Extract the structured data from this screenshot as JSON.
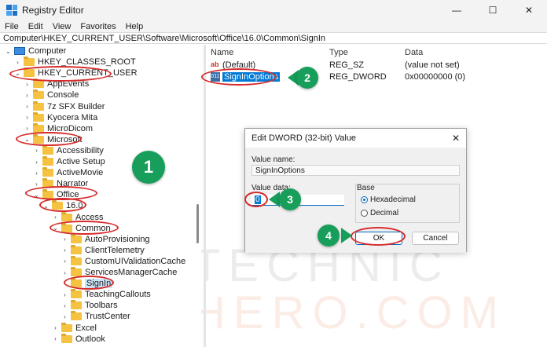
{
  "window": {
    "title": "Registry Editor",
    "minimize": "—",
    "maximize": "☐",
    "close": "✕"
  },
  "menu": [
    "File",
    "Edit",
    "View",
    "Favorites",
    "Help"
  ],
  "address": "Computer\\HKEY_CURRENT_USER\\Software\\Microsoft\\Office\\16.0\\Common\\SignIn",
  "tree": [
    {
      "label": "Computer",
      "chev": "⌄",
      "kind": "pc"
    },
    {
      "label": "HKEY_CLASSES_ROOT",
      "chev": "›",
      "kind": "folder"
    },
    {
      "label": "HKEY_CURRENT_USER",
      "chev": "⌄",
      "kind": "folder"
    },
    {
      "label": "AppEvents",
      "chev": "›",
      "kind": "folder"
    },
    {
      "label": "Console",
      "chev": "›",
      "kind": "folder"
    },
    {
      "label": "7z SFX Builder",
      "chev": "›",
      "kind": "folder"
    },
    {
      "label": "Kyocera Mita",
      "chev": "›",
      "kind": "folder"
    },
    {
      "label": "MicroDicom",
      "chev": "›",
      "kind": "folder"
    },
    {
      "label": "Microsoft",
      "chev": "⌄",
      "kind": "folder"
    },
    {
      "label": "Accessibility",
      "chev": "›",
      "kind": "folder"
    },
    {
      "label": "Active Setup",
      "chev": "›",
      "kind": "folder"
    },
    {
      "label": "ActiveMovie",
      "chev": "›",
      "kind": "folder"
    },
    {
      "label": "Narrator",
      "chev": "›",
      "kind": "folder"
    },
    {
      "label": "Office",
      "chev": "⌄",
      "kind": "folder"
    },
    {
      "label": "16.0",
      "chev": "⌄",
      "kind": "folder"
    },
    {
      "label": "Access",
      "chev": "›",
      "kind": "folder"
    },
    {
      "label": "Common",
      "chev": "⌄",
      "kind": "folder"
    },
    {
      "label": "AutoProvisioning",
      "chev": "›",
      "kind": "folder"
    },
    {
      "label": "ClientTelemetry",
      "chev": "›",
      "kind": "folder"
    },
    {
      "label": "CustomUIValidationCache",
      "chev": "›",
      "kind": "folder"
    },
    {
      "label": "ServicesManagerCache",
      "chev": "›",
      "kind": "folder"
    },
    {
      "label": "SignIn",
      "chev": "",
      "kind": "folder",
      "selected": true
    },
    {
      "label": "TeachingCallouts",
      "chev": "›",
      "kind": "folder"
    },
    {
      "label": "Toolbars",
      "chev": "›",
      "kind": "folder"
    },
    {
      "label": "TrustCenter",
      "chev": "›",
      "kind": "folder"
    },
    {
      "label": "Excel",
      "chev": "›",
      "kind": "folder"
    },
    {
      "label": "Outlook",
      "chev": "›",
      "kind": "folder"
    }
  ],
  "list": {
    "headers": {
      "name": "Name",
      "type": "Type",
      "data": "Data"
    },
    "rows": [
      {
        "name": "(Default)",
        "type": "REG_SZ",
        "data": "(value not set)",
        "icon": "ab"
      },
      {
        "name": "SignInOptions",
        "type": "REG_DWORD",
        "data": "0x00000000 (0)",
        "icon": "dword"
      }
    ],
    "icon_text": {
      "ab": "ab",
      "dword": "011"
    }
  },
  "dialog": {
    "title": "Edit DWORD (32-bit) Value",
    "value_name_label": "Value name:",
    "value_name": "SignInOptions",
    "value_data_label": "Value data:",
    "value_data": "0",
    "base_label": "Base",
    "hex_label": "Hexadecimal",
    "dec_label": "Decimal",
    "base_selected": "Hexadecimal",
    "ok": "OK",
    "cancel": "Cancel",
    "close": "✕"
  },
  "annotations": {
    "step1": "1",
    "step2": "2",
    "step3": "3",
    "step4": "4"
  },
  "watermark": {
    "line1": "TECHNIC",
    "line2": "HERO.COM"
  },
  "colors": {
    "accent": "#0078d4",
    "step_badge": "#179e5a",
    "highlight_ring": "#d62b2b",
    "folder": "#f5c242"
  }
}
